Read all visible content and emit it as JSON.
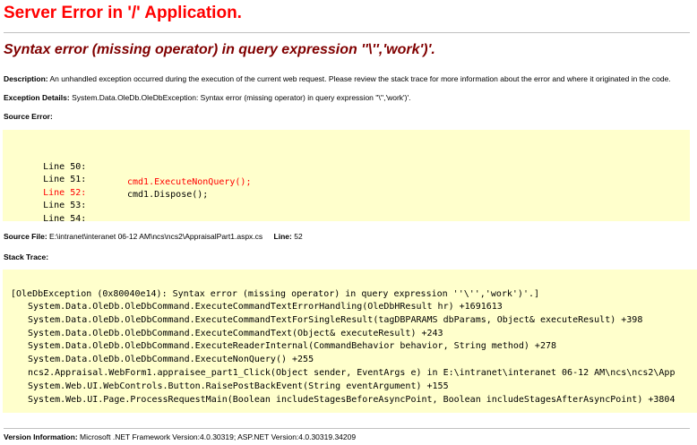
{
  "page": {
    "title": "Server Error in '/' Application.",
    "subtitle": "Syntax error (missing operator) in query expression ''\\'','work')'."
  },
  "description": {
    "label": "Description:",
    "text": "An unhandled exception occurred during the execution of the current web request. Please review the stack trace for more information about the error and where it originated in the code."
  },
  "exception_details": {
    "label": "Exception Details:",
    "text": "System.Data.OleDb.OleDbException: Syntax error (missing operator) in query expression ''\\'','work')'."
  },
  "source_error": {
    "label": "Source Error:",
    "lines": [
      {
        "num": "Line 50:",
        "code": ""
      },
      {
        "num": "Line 51:",
        "code": ""
      },
      {
        "num": "Line 52:",
        "code": "cmd1.ExecuteNonQuery();"
      },
      {
        "num": "Line 53:",
        "code": "cmd1.Dispose();"
      },
      {
        "num": "Line 54:",
        "code": ""
      }
    ]
  },
  "source_file": {
    "label": "Source File:",
    "path": "E:\\intranet\\interanet 06-12 AM\\ncs\\ncs2\\AppraisalPart1.aspx.cs",
    "line_label": "Line:",
    "line_value": "52"
  },
  "stack_trace": {
    "label": "Stack Trace:",
    "lines": [
      "[OleDbException (0x80040e14): Syntax error (missing operator) in query expression ''\\'','work')'.]",
      "System.Data.OleDb.OleDbCommand.ExecuteCommandTextErrorHandling(OleDbHResult hr) +1691613",
      "System.Data.OleDb.OleDbCommand.ExecuteCommandTextForSingleResult(tagDBPARAMS dbParams, Object& executeResult) +398",
      "System.Data.OleDb.OleDbCommand.ExecuteCommandText(Object& executeResult) +243",
      "System.Data.OleDb.OleDbCommand.ExecuteReaderInternal(CommandBehavior behavior, String method) +278",
      "System.Data.OleDb.OleDbCommand.ExecuteNonQuery() +255",
      "ncs2.Appraisal.WebForm1.appraisee_part1_Click(Object sender, EventArgs e) in E:\\intranet\\interanet 06-12 AM\\ncs\\ncs2\\App",
      "System.Web.UI.WebControls.Button.RaisePostBackEvent(String eventArgument) +155",
      "System.Web.UI.Page.ProcessRequestMain(Boolean includeStagesBeforeAsyncPoint, Boolean includeStagesAfterAsyncPoint) +3804"
    ]
  },
  "version": {
    "label": "Version Information:",
    "text": "Microsoft .NET Framework Version:4.0.30319; ASP.NET Version:4.0.30319.34209"
  },
  "colors": {
    "title": "#ff0000",
    "subtitle": "#800000",
    "code_background": "#ffffcc",
    "highlight_line": "#ff0000"
  }
}
